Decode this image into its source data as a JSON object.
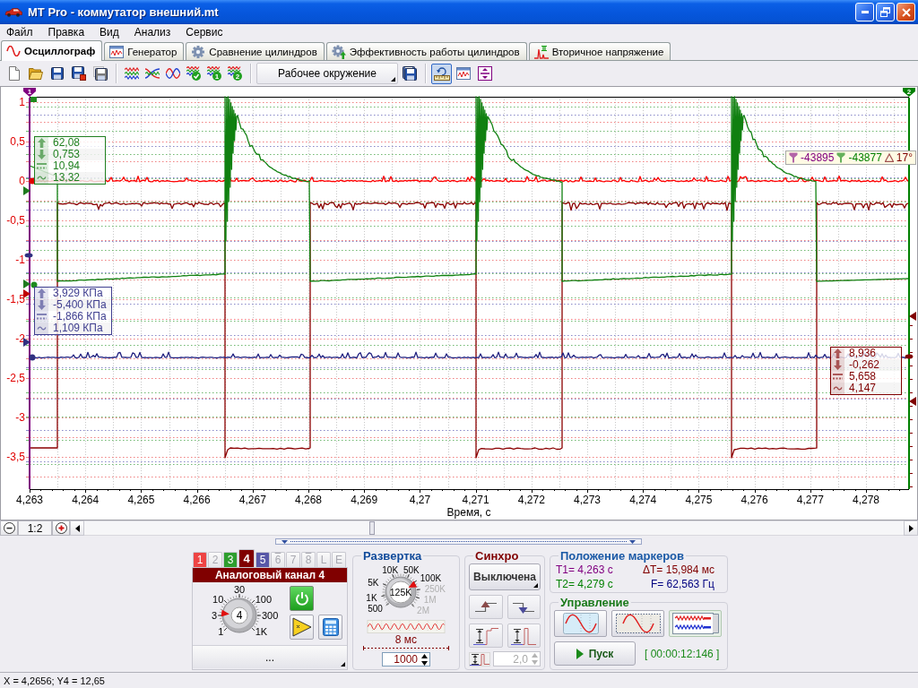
{
  "window": {
    "title": "MT Pro - коммутатор внешний.mt"
  },
  "menu": [
    "Файл",
    "Правка",
    "Вид",
    "Анализ",
    "Сервис"
  ],
  "tabs": [
    {
      "label": "Осциллограф",
      "selected": true
    },
    {
      "label": "Генератор",
      "selected": false
    },
    {
      "label": "Сравнение цилиндров",
      "selected": false
    },
    {
      "label": "Эффективность работы цилиндров",
      "selected": false
    },
    {
      "label": "Вторичное напряжение",
      "selected": false
    }
  ],
  "toolbar": {
    "preset_badges": [
      "1",
      "2"
    ],
    "workspace_button": "Рабочее окружение",
    "view_toggles": [
      {
        "selected": true
      },
      {
        "selected": false
      },
      {
        "selected": false
      }
    ]
  },
  "chart": {
    "y_labels": [
      "1",
      "0,5",
      "0",
      "-0,5",
      "-1",
      "-1,5",
      "-2",
      "-2,5",
      "-3",
      "-3,5"
    ],
    "x_labels": [
      "4,263",
      "4,264",
      "4,265",
      "4,266",
      "4,267",
      "4,268",
      "4,269",
      "4,27",
      "4,271",
      "4,272",
      "4,273",
      "4,274",
      "4,275",
      "4,276",
      "4,277",
      "4,278"
    ],
    "x_title": "Время, с",
    "markers": [
      {
        "label": "1",
        "color": "#800080"
      },
      {
        "label": "2",
        "color": "#008000"
      }
    ],
    "readouts": [
      {
        "color": "#208020",
        "values": [
          "62,08",
          "0,753",
          "10,94",
          "13,32"
        ]
      },
      {
        "color": "#404090",
        "values": [
          "3,929 КПа",
          "-5,400 КПа",
          "-1,866 КПа",
          "1,109 КПа"
        ]
      },
      {
        "color": "#800000",
        "values": [
          "8,936",
          "-0,262",
          "5,658",
          "4,147"
        ]
      }
    ],
    "marker_readout": {
      "t1": "-43895",
      "t2": "-43877",
      "delta": "17°"
    }
  },
  "zoom_bar": {
    "scale": "1:2"
  },
  "channel_panel": {
    "tabs": [
      {
        "label": "1",
        "selected": false,
        "overlined": false,
        "color": "#ee4444"
      },
      {
        "label": "2",
        "selected": false,
        "overlined": false
      },
      {
        "label": "3",
        "selected": false,
        "overlined": false,
        "color": "#2e9e2e"
      },
      {
        "label": "4",
        "selected": true,
        "overlined": false,
        "color": "#800000"
      },
      {
        "label": "5",
        "selected": false,
        "overlined": false,
        "color": "#5858a8"
      },
      {
        "label": "6",
        "selected": false,
        "overlined": true
      },
      {
        "label": "7",
        "selected": false,
        "overlined": false
      },
      {
        "label": "8",
        "selected": false,
        "overlined": true
      },
      {
        "label": "L",
        "selected": false,
        "overlined": false
      },
      {
        "label": "E",
        "selected": false,
        "overlined": false
      }
    ],
    "title": "Аналоговый канал 4",
    "dial": {
      "labels": [
        "30",
        "10",
        "100",
        "3",
        "300",
        "1",
        "1K"
      ],
      "value": "4",
      "level": 0.19
    },
    "more_button": "..."
  },
  "sweep": {
    "title": "Развертка",
    "dial": {
      "labels": [
        {
          "text": "10K",
          "disabled": false
        },
        {
          "text": "50K",
          "disabled": false
        },
        {
          "text": "100K",
          "disabled": false
        },
        {
          "text": "5K",
          "disabled": false
        },
        {
          "text": "250K",
          "disabled": true
        },
        {
          "text": "1K",
          "disabled": false
        },
        {
          "text": "1M",
          "disabled": true
        },
        {
          "text": "500",
          "disabled": false
        },
        {
          "text": "2M",
          "disabled": true
        }
      ],
      "value": "125K",
      "level": 0.73
    },
    "period": "8 мс",
    "points": "1000"
  },
  "sync": {
    "title": "Синхро",
    "mode_button": "Выключена",
    "level_field": {
      "value": "2,0",
      "disabled": true
    }
  },
  "marker_positions": {
    "title": "Положение маркеров",
    "readings": [
      {
        "text": "T1= 4,263 с",
        "color": "#800080"
      },
      {
        "text": "ΔT= 15,984 мс",
        "color": "#800000"
      },
      {
        "text": "T2= 4,279 с",
        "color": "#008000"
      },
      {
        "text": "F= 62,563 Гц",
        "color": "#000080"
      }
    ]
  },
  "control": {
    "title": "Управление",
    "view_buttons": [
      {
        "selected": false
      },
      {
        "selected": false
      },
      {
        "selected": true
      }
    ],
    "start_button": "Пуск",
    "timer": "[ 00:00:12:146 ]"
  },
  "status_bar": "X = 4,2656; Y4 = 12,65"
}
